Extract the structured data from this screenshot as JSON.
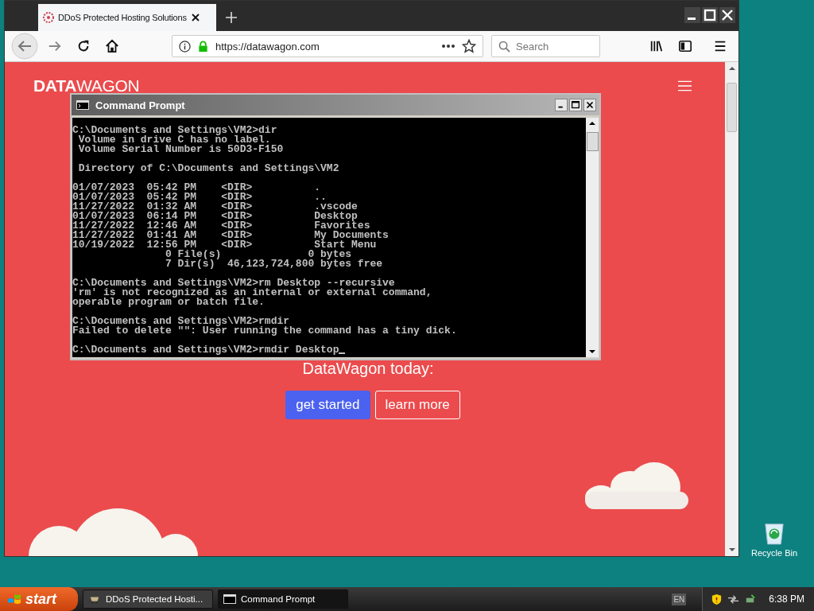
{
  "browser": {
    "tab": {
      "title": "DDoS Protected Hosting Solutions"
    },
    "url": "https://datawagon.com",
    "search": {
      "placeholder": "Search"
    }
  },
  "page": {
    "logo": "**DATA**WAGON",
    "headline": "DataWagon today:",
    "buttons": [
      {
        "label": "get started",
        "kind": "primary"
      },
      {
        "label": "learn more",
        "kind": "outline"
      }
    ]
  },
  "console": {
    "title": "Command Prompt",
    "blocks": [
      [
        "C:\\Documents and Settings\\VM2>dir",
        " Volume in drive C has no label.",
        " Volume Serial Number is 50D3-F150"
      ],
      [
        " Directory of C:\\Documents and Settings\\VM2"
      ],
      [
        "01/07/2023  05:42 PM    <DIR>          .",
        "01/07/2023  05:42 PM    <DIR>          ..",
        "11/27/2022  01:32 AM    <DIR>          .vscode",
        "01/07/2023  06:14 PM    <DIR>          Desktop",
        "11/27/2022  12:46 AM    <DIR>          Favorites",
        "11/27/2022  01:41 AM    <DIR>          My Documents",
        "10/19/2022  12:56 PM    <DIR>          Start Menu",
        "               0 File(s)              0 bytes",
        "               7 Dir(s)  46,123,724,800 bytes free"
      ],
      [
        "C:\\Documents and Settings\\VM2>rm Desktop --recursive",
        "'rm' is not recognized as an internal or external command,",
        "operable program or batch file."
      ],
      [
        "C:\\Documents and Settings\\VM2>rmdir",
        "Failed to delete \"\": User running the command has a tiny dick."
      ],
      [
        "C:\\Documents and Settings\\VM2>rmdir Desktop"
      ]
    ]
  },
  "desktop": {
    "icons": [
      {
        "label": "Recycle Bin"
      }
    ]
  },
  "taskbar": {
    "start": "start",
    "tasks": [
      {
        "label": "DDoS Protected Hosti...",
        "selected": false
      },
      {
        "label": "Command Prompt",
        "selected": true
      }
    ],
    "language": "EN",
    "clock": "6:38 PM"
  }
}
